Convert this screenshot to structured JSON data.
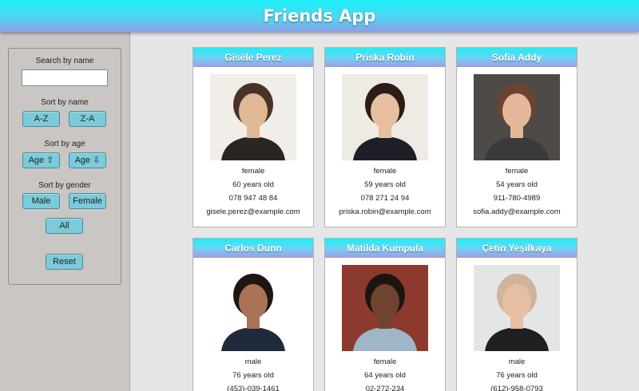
{
  "app": {
    "title": "Friends App"
  },
  "sidebar": {
    "search_label": "Search by name",
    "search_value": "",
    "sort_name_label": "Sort by name",
    "az_label": "A-Z",
    "za_label": "Z-A",
    "sort_age_label": "Sort by age",
    "age_up_label": "Age ⇧",
    "age_down_label": "Age ⇩",
    "gender_label": "Sort by gender",
    "male_label": "Male",
    "female_label": "Female",
    "all_label": "All",
    "reset_label": "Reset"
  },
  "friends": [
    {
      "name": "Gisèle Perez",
      "gender": "female",
      "age": "60 years old",
      "phone": "078 947 48 84",
      "email": "gisele.perez@example.com",
      "colors": {
        "bg": "#f1ede8",
        "hair": "#4a3326",
        "skin": "#e0b896",
        "shirt": "#2a2624"
      }
    },
    {
      "name": "Priska Robin",
      "gender": "female",
      "age": "59 years old",
      "phone": "078 271 24 94",
      "email": "priska.robin@example.com",
      "colors": {
        "bg": "#eeeae4",
        "hair": "#2c1c15",
        "skin": "#e6bfa0",
        "shirt": "#1e1f26"
      }
    },
    {
      "name": "Sofia Addy",
      "gender": "female",
      "age": "54 years old",
      "phone": "911-780-4989",
      "email": "sofia.addy@example.com",
      "colors": {
        "bg": "#4d4a48",
        "hair": "#6a4331",
        "skin": "#e4b79a",
        "shirt": "#3a3a3c"
      }
    },
    {
      "name": "Carlos Dunn",
      "gender": "male",
      "age": "76 years old",
      "phone": "(453)-039-1461",
      "email": "",
      "colors": {
        "bg": "#ffffff",
        "hair": "#1e1612",
        "skin": "#a87455",
        "shirt": "#1f2a3b"
      }
    },
    {
      "name": "Matilda Kumpula",
      "gender": "female",
      "age": "64 years old",
      "phone": "02-272-234",
      "email": "",
      "colors": {
        "bg": "#8c3a2e",
        "hair": "#1c1410",
        "skin": "#6e4430",
        "shirt": "#9fb6c9"
      }
    },
    {
      "name": "Çetin Yeşilkaya",
      "gender": "male",
      "age": "76 years old",
      "phone": "(612)-958-0793",
      "email": "",
      "colors": {
        "bg": "#e4e6e6",
        "hair": "#cdb49a",
        "skin": "#e6bea3",
        "shirt": "#202022"
      }
    }
  ]
}
